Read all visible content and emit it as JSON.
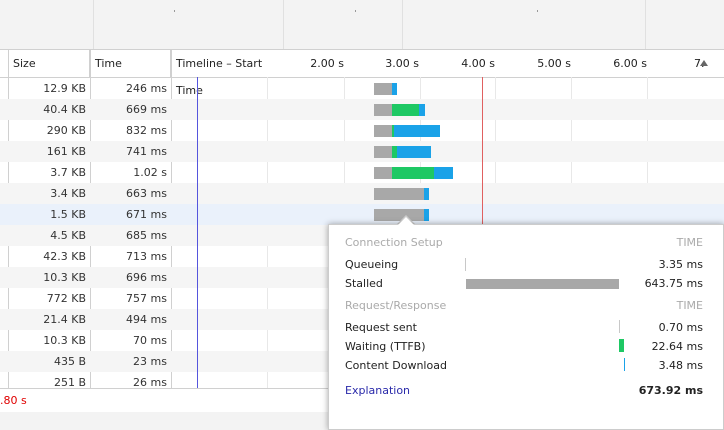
{
  "columns": {
    "size": "Size",
    "time": "Time",
    "timeline": "Timeline – Start Time"
  },
  "ticks": [
    "2.00 s",
    "3.00 s",
    "4.00 s",
    "5.00 s",
    "6.00 s",
    "7."
  ],
  "rows": [
    {
      "size": "12.9 KB",
      "time": "246 ms",
      "wait": 0.0,
      "ttfb": 0.0,
      "dl": 0.06
    },
    {
      "size": "40.4 KB",
      "time": "669 ms",
      "wait": 0.4,
      "ttfb": 0.35,
      "dl": 0.08
    },
    {
      "size": "290 KB",
      "time": "832 ms",
      "wait": 0.0,
      "ttfb": 0.02,
      "dl": 0.6
    },
    {
      "size": "161 KB",
      "time": "741 ms",
      "wait": 0.0,
      "ttfb": 0.06,
      "dl": 0.45
    },
    {
      "size": "3.7 KB",
      "time": "1.02 s",
      "wait": 0.0,
      "ttfb": 0.55,
      "dl": 0.25
    },
    {
      "size": "3.4 KB",
      "time": "663 ms",
      "wait": 0.0,
      "ttfb": 0.0,
      "dl": 0.06
    },
    {
      "size": "1.5 KB",
      "time": "671 ms",
      "wait": 0.0,
      "ttfb": 0.0,
      "dl": 0.06
    },
    {
      "size": "4.5 KB",
      "time": "685 ms"
    },
    {
      "size": "42.3 KB",
      "time": "713 ms"
    },
    {
      "size": "10.3 KB",
      "time": "696 ms"
    },
    {
      "size": "772 KB",
      "time": "757 ms"
    },
    {
      "size": "21.4 KB",
      "time": "494 ms"
    },
    {
      "size": "10.3 KB",
      "time": "70 ms"
    },
    {
      "size": "435 B",
      "time": "23 ms"
    },
    {
      "size": "251 B",
      "time": "26 ms"
    }
  ],
  "status": ".80 s",
  "tooltip": {
    "connection_setup": "Connection Setup",
    "time_header": "TIME",
    "queueing_label": "Queueing",
    "queueing_value": "3.35 ms",
    "stalled_label": "Stalled",
    "stalled_value": "643.75 ms",
    "request_response": "Request/Response",
    "time_header2": "TIME",
    "request_sent_label": "Request sent",
    "request_sent_value": "0.70 ms",
    "waiting_label": "Waiting (TTFB)",
    "waiting_value": "22.64 ms",
    "download_label": "Content Download",
    "download_value": "3.48 ms",
    "explanation": "Explanation",
    "total": "673.92 ms"
  },
  "colors": {
    "stalled": "#a8a8a8",
    "waiting": "#1ec864",
    "download": "#1aa2e8",
    "tooltip_waiting": "#1ec864",
    "tooltip_download": "#1aa2e8"
  }
}
